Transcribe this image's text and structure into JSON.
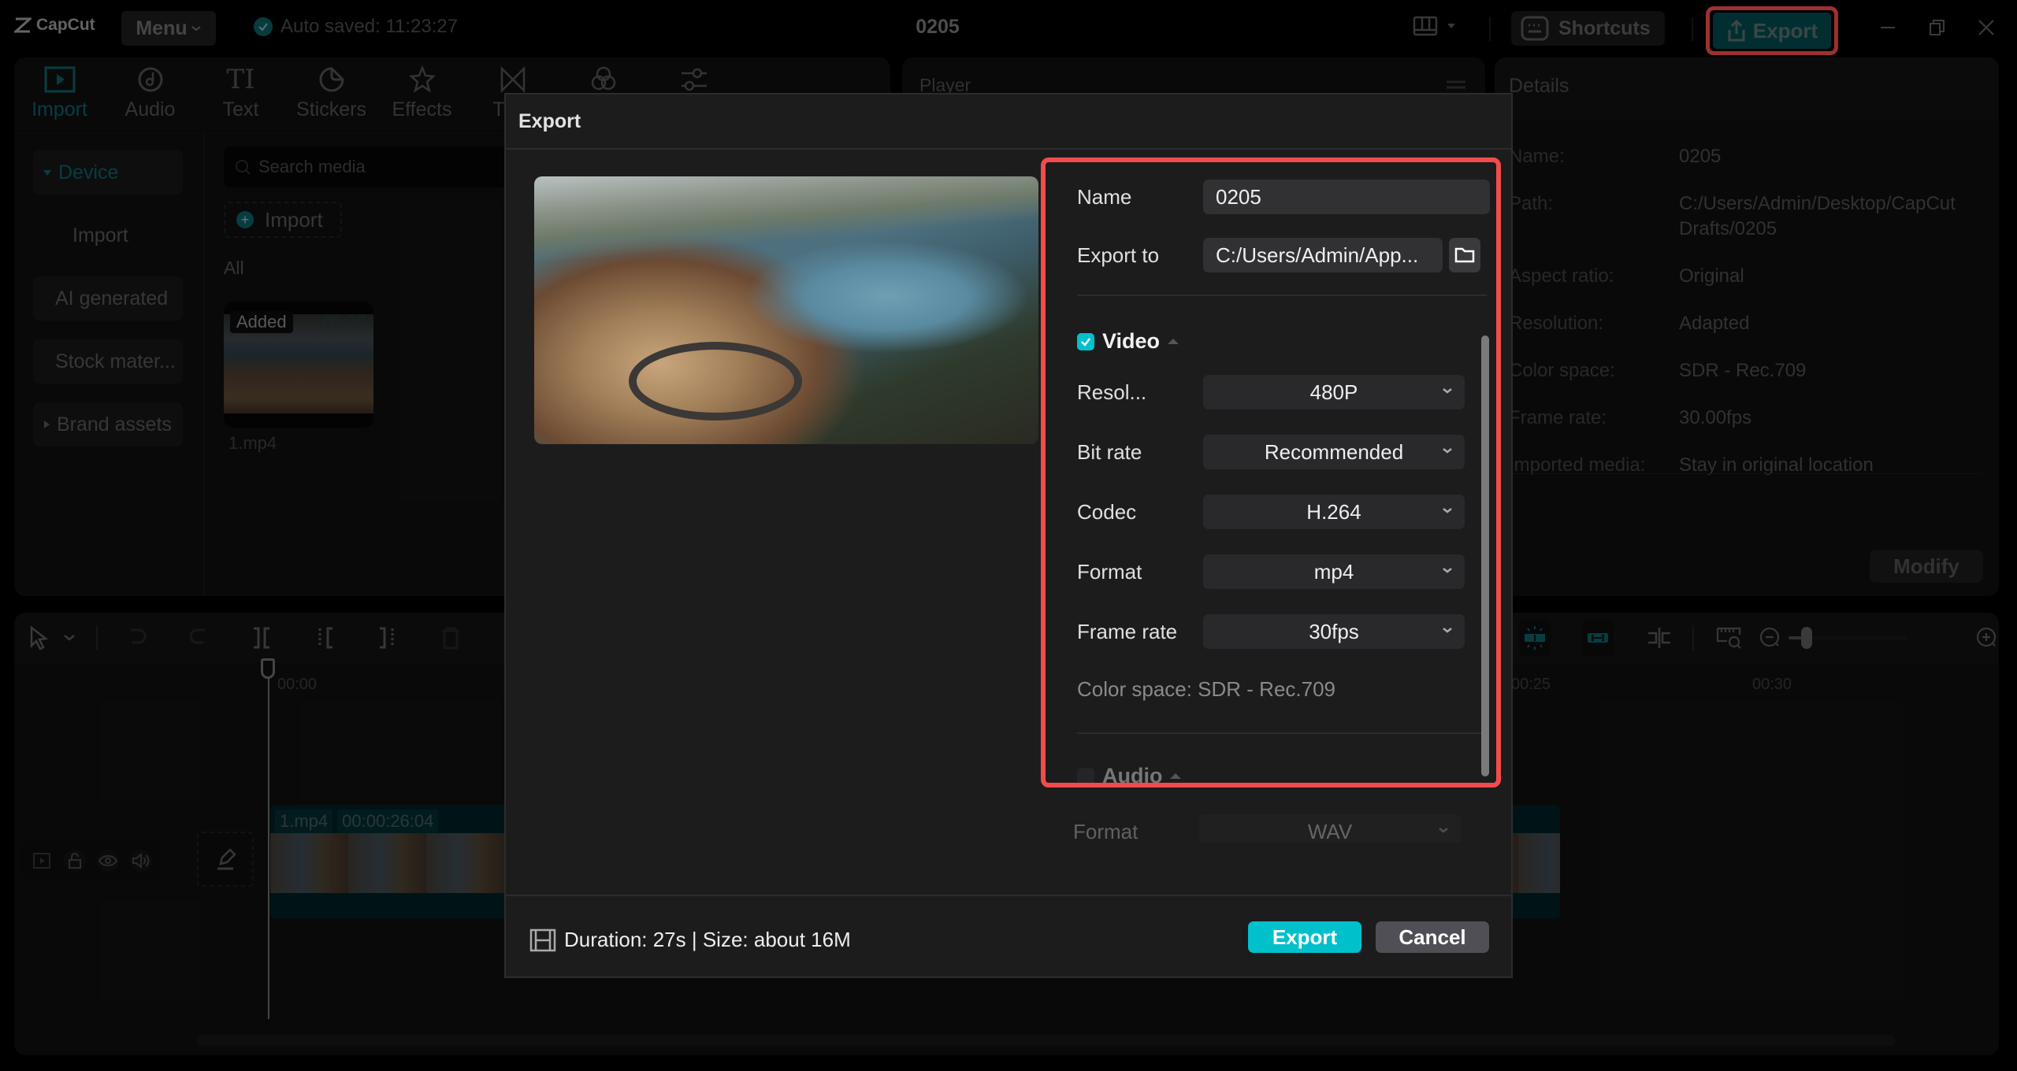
{
  "app": {
    "name": "CapCut",
    "menu_label": "Menu",
    "autosave": "Auto saved: 11:23:27",
    "project_title": "0205",
    "shortcuts_label": "Shortcuts",
    "export_label": "Export"
  },
  "toolbar_tabs": [
    {
      "label": "Import",
      "icon": "import-icon",
      "active": true
    },
    {
      "label": "Audio",
      "icon": "audio-icon"
    },
    {
      "label": "Text",
      "icon": "text-icon"
    },
    {
      "label": "Stickers",
      "icon": "stickers-icon"
    },
    {
      "label": "Effects",
      "icon": "effects-icon"
    },
    {
      "label": "Tran",
      "icon": "transitions-icon"
    },
    {
      "label": "",
      "icon": "filters-icon"
    },
    {
      "label": "",
      "icon": "adjustment-icon"
    }
  ],
  "media_sidebar": [
    {
      "label": "Device",
      "active": true,
      "expander": "down"
    },
    {
      "label": "Import",
      "plain": true
    },
    {
      "label": "AI generated"
    },
    {
      "label": "Stock mater..."
    },
    {
      "label": "Brand assets",
      "expander": "right"
    }
  ],
  "media": {
    "search_placeholder": "Search media",
    "import_label": "Import",
    "filter_label": "All",
    "items": [
      {
        "name": "1.mp4",
        "badge": "Added",
        "duration": "00:27"
      }
    ]
  },
  "player": {
    "title": "Player"
  },
  "details": {
    "title": "Details",
    "rows": [
      {
        "key": "Name:",
        "value": "0205"
      },
      {
        "key": "Path:",
        "value": "C:/Users/Admin/Desktop/CapCut Drafts/0205"
      },
      {
        "key": "Aspect ratio:",
        "value": "Original"
      },
      {
        "key": "Resolution:",
        "value": "Adapted"
      },
      {
        "key": "Color space:",
        "value": "SDR - Rec.709"
      },
      {
        "key": "Frame rate:",
        "value": "30.00fps"
      },
      {
        "key": "Imported media:",
        "value": "Stay in original location"
      }
    ],
    "modify_label": "Modify"
  },
  "timeline": {
    "ruler_labels": [
      "00:00",
      "00:25",
      "00:30"
    ],
    "clip": {
      "name": "1.mp4",
      "duration": "00:00:26:04"
    },
    "zoom_level": 0.12
  },
  "export_dialog": {
    "title": "Export",
    "name_label": "Name",
    "name_value": "0205",
    "export_to_label": "Export to",
    "export_to_value": "C:/Users/Admin/App...",
    "video": {
      "label": "Video",
      "checked": true,
      "settings": [
        {
          "label": "Resol...",
          "value": "480P"
        },
        {
          "label": "Bit rate",
          "value": "Recommended"
        },
        {
          "label": "Codec",
          "value": "H.264"
        },
        {
          "label": "Format",
          "value": "mp4"
        },
        {
          "label": "Frame rate",
          "value": "30fps"
        }
      ],
      "color_space": "Color space: SDR - Rec.709"
    },
    "audio": {
      "label": "Audio",
      "checked": false,
      "settings": [
        {
          "label": "Format",
          "value": "WAV"
        }
      ]
    },
    "footer_info": "Duration: 27s | Size: about 16M",
    "export_button": "Export",
    "cancel_button": "Cancel"
  },
  "colors": {
    "accent": "#00c0cc",
    "highlight": "#f24b4b",
    "dim_accent": "#0b5e63"
  }
}
